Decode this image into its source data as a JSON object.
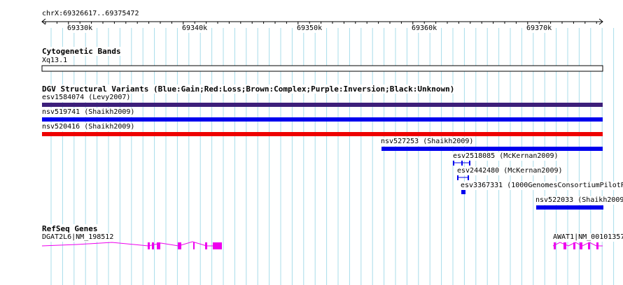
{
  "ruler": {
    "coords": "chrX:69326617..69375472",
    "ticks": [
      "69330k",
      "69340k",
      "69350k",
      "69360k",
      "69370k"
    ]
  },
  "cytoband": {
    "title": "Cytogenetic Bands",
    "band": "Xq13.1"
  },
  "dgv": {
    "title": "DGV Structural Variants (Blue:Gain;Red:Loss;Brown:Complex;Purple:Inversion;Black:Unknown)",
    "colors": {
      "purple": "#3d1f7a",
      "blue": "#0000ee",
      "red": "#ee0000"
    },
    "variants": [
      {
        "label": "esv1584074 (Levy2007)",
        "color": "purple"
      },
      {
        "label": "nsv519741 (Shaikh2009)",
        "color": "blue"
      },
      {
        "label": "nsv520416 (Shaikh2009)",
        "color": "red"
      },
      {
        "label": "nsv527253 (Shaikh2009)",
        "color": "blue"
      },
      {
        "label": "esv2518085 (McKernan2009)",
        "color": "blue"
      },
      {
        "label": "esv2442480 (McKernan2009)",
        "color": "blue"
      },
      {
        "label": "esv3367331 (1000GenomesConsortiumPilotP",
        "color": "blue"
      },
      {
        "label": "nsv522033 (Shaikh2009",
        "color": "blue"
      }
    ]
  },
  "refseq": {
    "title": "RefSeq Genes",
    "color": "#ee00ee",
    "genes": [
      {
        "label": "DGAT2L6|NM_198512"
      },
      {
        "label": "AWAT1|NM_00101357"
      }
    ]
  }
}
